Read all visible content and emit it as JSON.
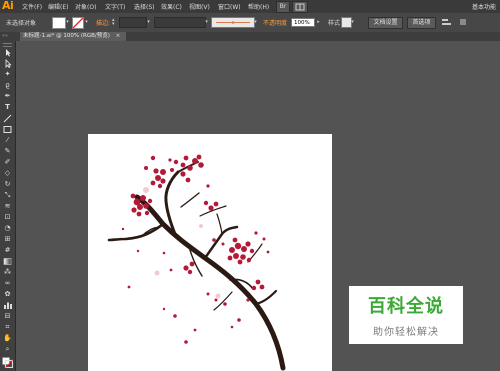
{
  "app": {
    "logo": "Ai",
    "workspace": "基本功能"
  },
  "menu": [
    "文件(F)",
    "编辑(E)",
    "对象(O)",
    "文字(T)",
    "选择(S)",
    "效果(C)",
    "视图(V)",
    "窗口(W)",
    "帮助(H)"
  ],
  "control_bar": {
    "selection_status": "未选择对象",
    "stroke_label": "描边:",
    "opacity_label": "不透明度",
    "opacity_value": "100%",
    "style_label": "样式",
    "doc_setup_button": "文档设置",
    "preferences_button": "首选项"
  },
  "document_tab": {
    "title": "未标题-1.ai* @ 100% (RGB/预览)",
    "close": "×"
  },
  "tools": [
    "selection-tool",
    "direct-selection-tool",
    "magic-wand-tool",
    "lasso-tool",
    "pen-tool",
    "type-tool",
    "line-tool",
    "rectangle-tool",
    "paintbrush-tool",
    "pencil-tool",
    "blob-brush-tool",
    "eraser-tool",
    "rotate-tool",
    "scale-tool",
    "width-tool",
    "free-transform-tool",
    "shape-builder-tool",
    "perspective-grid-tool",
    "mesh-tool",
    "gradient-tool",
    "eyedropper-tool",
    "blend-tool",
    "symbol-sprayer-tool",
    "column-graph-tool",
    "artboard-tool",
    "slice-tool",
    "hand-tool",
    "zoom-tool"
  ],
  "watermark": {
    "title": "百科全说",
    "subtitle": "助你轻松解决"
  },
  "colors": {
    "accent": "#ff9a00",
    "blossom": "#b5193a",
    "branch": "#2b1a14",
    "watermark_green": "#3aa935"
  }
}
